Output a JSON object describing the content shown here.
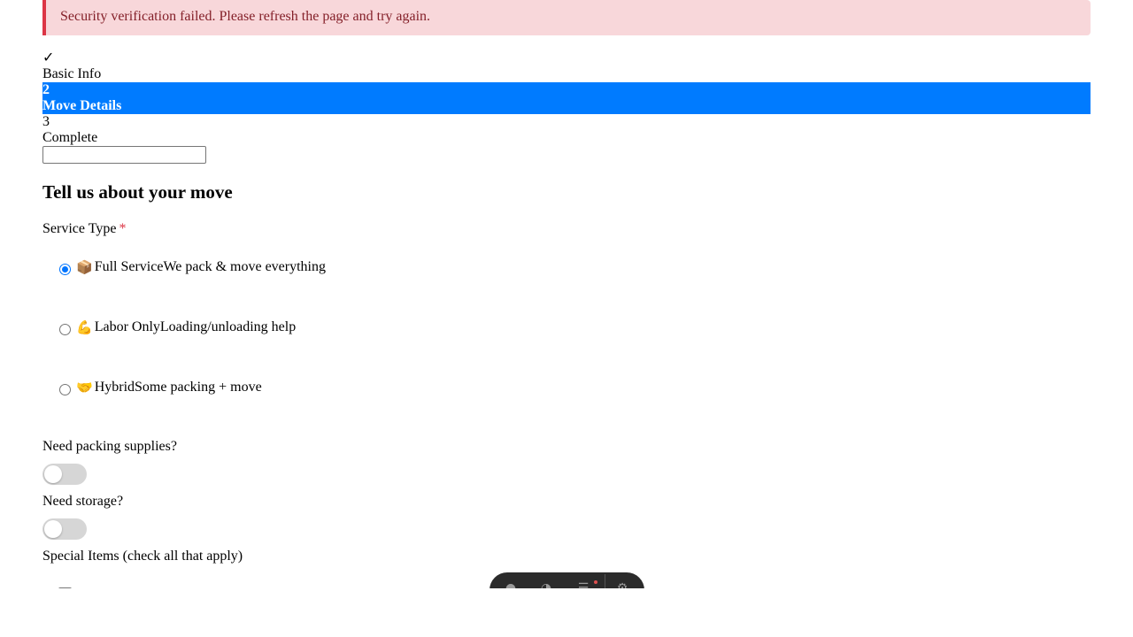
{
  "alert": {
    "message": "Security verification failed. Please refresh the page and try again."
  },
  "steps": [
    {
      "number": "✓",
      "label": "Basic Info",
      "state": "done"
    },
    {
      "number": "2",
      "label": "Move Details",
      "state": "active"
    },
    {
      "number": "3",
      "label": "Complete",
      "state": "pending"
    }
  ],
  "colors": {
    "active_step": "#007bff",
    "alert_bg": "#f8d7da",
    "alert_border": "#dc3545",
    "radio_checked": "#0075ff"
  },
  "form": {
    "title": "Tell us about your move",
    "service_type": {
      "label": "Service Type",
      "required_mark": "*",
      "options": [
        {
          "emoji": "📦",
          "name": "Full Service",
          "desc": "We pack & move everything",
          "selected": true
        },
        {
          "emoji": "💪",
          "name": "Labor Only",
          "desc": "Loading/unloading help",
          "selected": false
        },
        {
          "emoji": "🤝",
          "name": "Hybrid",
          "desc": "Some packing + move",
          "selected": false
        }
      ]
    },
    "packing_supplies": {
      "label": "Need packing supplies?",
      "on": false
    },
    "storage": {
      "label": "Need storage?",
      "on": false
    },
    "special_items": {
      "label": "Special Items (check all that apply)"
    }
  },
  "dock": {
    "icons": [
      "mic-icon",
      "timer-icon",
      "list-icon",
      "settings-icon"
    ]
  }
}
